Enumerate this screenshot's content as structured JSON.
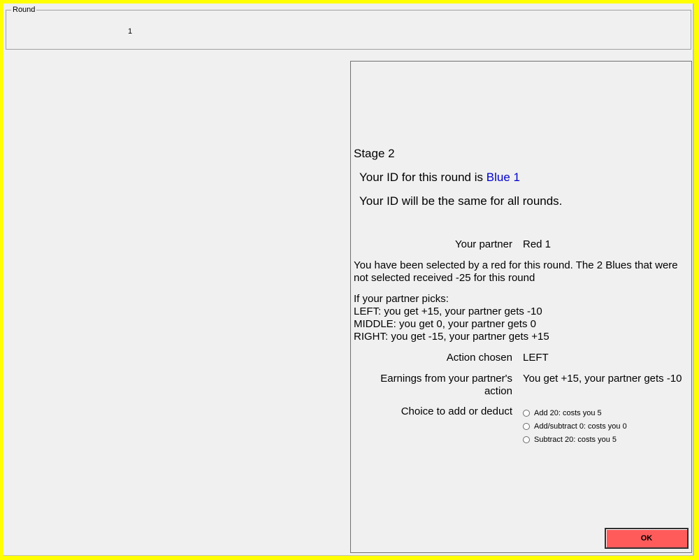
{
  "round_box": {
    "legend": "Round",
    "value": "1"
  },
  "panel": {
    "stage_title": "Stage 2",
    "id_prefix": "Your ID for this round is ",
    "id_value": "Blue 1",
    "same_id_text": "Your ID will be the same for all rounds.",
    "partner": {
      "label": "Your partner",
      "value": "Red 1"
    },
    "selection_text": "You have been selected by a red for this round. The 2 Blues that were not selected received -25 for this round",
    "picks_intro": "If your partner picks:",
    "pick_left": "LEFT: you get +15, your partner gets -10",
    "pick_middle": "MIDDLE: you get 0, your partner gets 0",
    "pick_right": "RIGHT: you get -15, your partner gets +15",
    "action_chosen": {
      "label": "Action chosen",
      "value": "LEFT"
    },
    "earnings": {
      "label": "Earnings from your partner's action",
      "value": "You get +15, your partner gets -10"
    },
    "choice": {
      "label": "Choice to add or deduct",
      "options": [
        "Add 20: costs you 5",
        "Add/subtract 0: costs you 0",
        "Subtract 20: costs you 5"
      ],
      "selected": null
    },
    "ok_label": "OK"
  },
  "colors": {
    "frame": "#ffff00",
    "window_bg": "#f0f0f0",
    "id_highlight": "#0000cc",
    "ok_button": "#ff5b5b"
  }
}
